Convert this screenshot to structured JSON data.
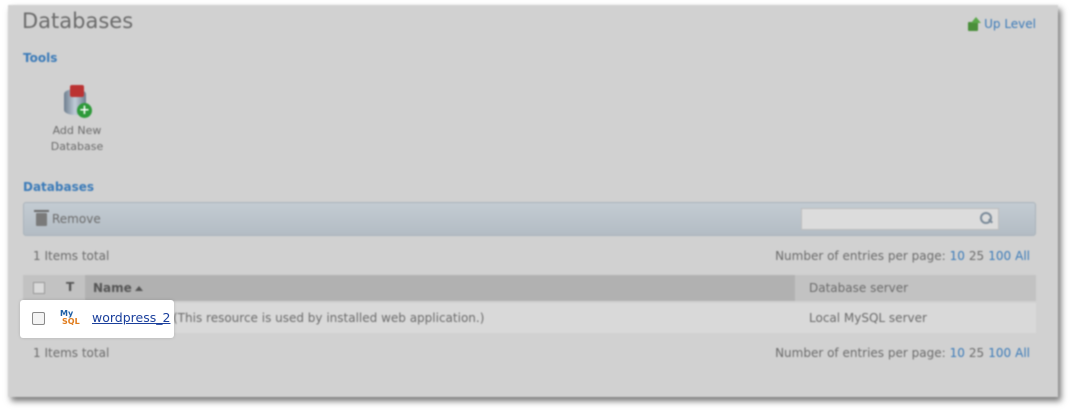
{
  "header": {
    "title": "Databases",
    "up_level_label": "Up Level"
  },
  "tools": {
    "section_label": "Tools",
    "add_new_database_line1": "Add New",
    "add_new_database_line2": "Database"
  },
  "databases": {
    "section_label": "Databases",
    "toolbar": {
      "remove_label": "Remove",
      "search_value": ""
    },
    "items_total_top": "1 Items total",
    "items_total_bottom": "1 Items total",
    "per_page": {
      "label": "Number of entries per page:",
      "options": [
        "10",
        "25",
        "100",
        "All"
      ],
      "current": "25"
    },
    "columns": {
      "type": "T",
      "name": "Name",
      "server": "Database server"
    },
    "rows": [
      {
        "type_icon": "mysql-icon",
        "type_text_1": "My",
        "type_text_2": "SQL",
        "name": "wordpress_2",
        "description": "(This resource is used by installed web application.)",
        "server": "Local MySQL server"
      }
    ]
  },
  "colors": {
    "link": "#3a7ab8",
    "background": "#d1d1d1",
    "highlight": "#ffffff"
  }
}
